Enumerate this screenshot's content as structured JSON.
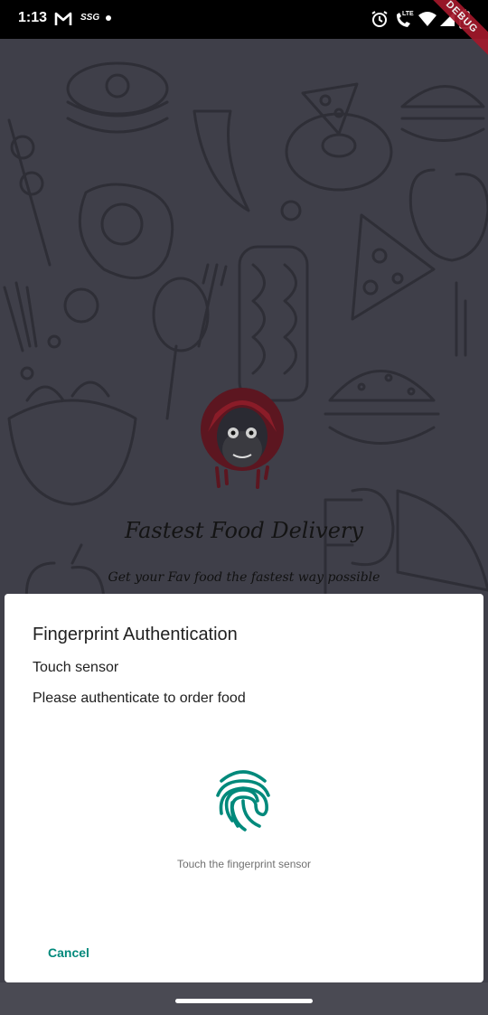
{
  "status_bar": {
    "time": "1:13",
    "network_label": "SSG",
    "lte_label": "LTE",
    "debug_label": "DEBUG",
    "icons": [
      "gmail-icon",
      "alarm-icon",
      "call-lte-icon",
      "wifi-icon",
      "signal-icon",
      "battery-icon"
    ]
  },
  "splash": {
    "tagline": "Fastest Food Delivery",
    "sub_tagline": "Get your Fav food the fastest way possible"
  },
  "dialog": {
    "title": "Fingerprint Authentication",
    "subtitle": "Touch sensor",
    "description": "Please authenticate to order food",
    "hint": "Touch the fingerprint sensor",
    "cancel_label": "Cancel",
    "accent_color": "#00897b"
  }
}
